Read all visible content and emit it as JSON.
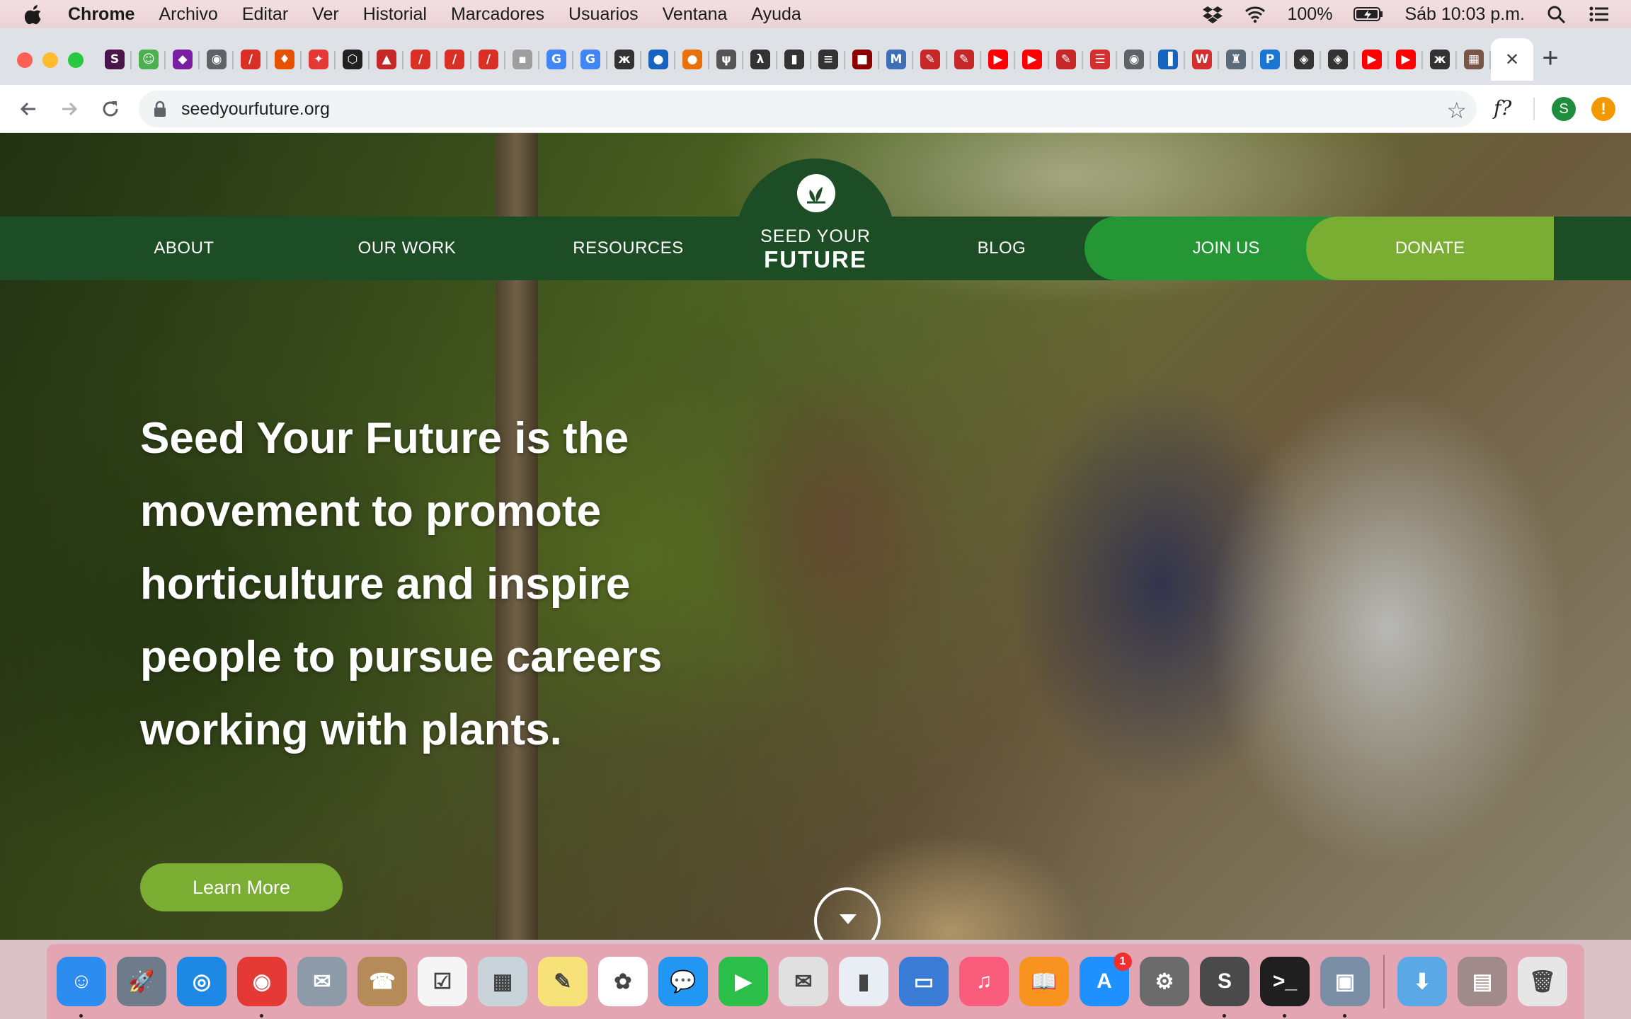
{
  "menubar": {
    "items": [
      "Chrome",
      "Archivo",
      "Editar",
      "Ver",
      "Historial",
      "Marcadores",
      "Usuarios",
      "Ventana",
      "Ayuda"
    ],
    "battery": "100%",
    "clock": "Sáb 10:03 p.m."
  },
  "browser": {
    "url": "seedyourfuture.org",
    "extension_label": "f?",
    "profile_initial": "S",
    "alert_symbol": "!",
    "tab_favicons": [
      {
        "glyph": "S",
        "color": "#4a154b"
      },
      {
        "glyph": "☺",
        "color": "#4caf50"
      },
      {
        "glyph": "◆",
        "color": "#7b1fa2"
      },
      {
        "glyph": "◉",
        "color": "#5f6368"
      },
      {
        "glyph": "/",
        "color": "#d93025"
      },
      {
        "glyph": "♦",
        "color": "#e65100"
      },
      {
        "glyph": "✦",
        "color": "#e53935"
      },
      {
        "glyph": "⬡",
        "color": "#212121"
      },
      {
        "glyph": "▲",
        "color": "#c62828"
      },
      {
        "glyph": "/",
        "color": "#d93025"
      },
      {
        "glyph": "/",
        "color": "#d93025"
      },
      {
        "glyph": "/",
        "color": "#d93025"
      },
      {
        "glyph": "▪",
        "color": "#9e9e9e"
      },
      {
        "glyph": "G",
        "color": "#4285f4"
      },
      {
        "glyph": "G",
        "color": "#4285f4"
      },
      {
        "glyph": "ж",
        "color": "#333333"
      },
      {
        "glyph": "●",
        "color": "#1565c0"
      },
      {
        "glyph": "●",
        "color": "#e8710a"
      },
      {
        "glyph": "ψ",
        "color": "#555555"
      },
      {
        "glyph": "λ",
        "color": "#333333"
      },
      {
        "glyph": "▮",
        "color": "#333333"
      },
      {
        "glyph": "≡",
        "color": "#333333"
      },
      {
        "glyph": "■",
        "color": "#8b0000"
      },
      {
        "glyph": "M",
        "color": "#3f6fb5"
      },
      {
        "glyph": "✎",
        "color": "#c62828"
      },
      {
        "glyph": "✎",
        "color": "#c62828"
      },
      {
        "glyph": "▶",
        "color": "#ff0000"
      },
      {
        "glyph": "▶",
        "color": "#ff0000"
      },
      {
        "glyph": "✎",
        "color": "#c62828"
      },
      {
        "glyph": "☰",
        "color": "#d32f2f"
      },
      {
        "glyph": "◉",
        "color": "#5f6368"
      },
      {
        "glyph": "▐",
        "color": "#1565c0"
      },
      {
        "glyph": "W",
        "color": "#d32f2f"
      },
      {
        "glyph": "♜",
        "color": "#5c6b7a"
      },
      {
        "glyph": "P",
        "color": "#1976d2"
      },
      {
        "glyph": "◈",
        "color": "#333333"
      },
      {
        "glyph": "◈",
        "color": "#333333"
      },
      {
        "glyph": "▶",
        "color": "#ff0000"
      },
      {
        "glyph": "▶",
        "color": "#ff0000"
      },
      {
        "glyph": "ж",
        "color": "#333333"
      },
      {
        "glyph": "▦",
        "color": "#795548"
      }
    ],
    "active_tab_close": "✕",
    "new_tab": "+"
  },
  "site": {
    "nav": {
      "about": "ABOUT",
      "our_work": "OUR WORK",
      "resources": "RESOURCES",
      "blog": "BLOG",
      "join": "JOIN US",
      "donate": "DONATE"
    },
    "logo": {
      "line1": "SEED YOUR",
      "line2": "FUTURE"
    },
    "hero_text": "Seed Your Future is the movement to promote horticulture and inspire people to pursue careers working with plants.",
    "cta_label": "Learn More",
    "colors": {
      "nav_green": "#1d4d24",
      "join_green": "#249633",
      "donate_green": "#7aae33"
    }
  },
  "dock": {
    "items": [
      {
        "glyph": "☺",
        "color": "#2d8cf0",
        "running": true
      },
      {
        "glyph": "🚀",
        "color": "#6e7b8b"
      },
      {
        "glyph": "◎",
        "color": "#1e88e5"
      },
      {
        "glyph": "◉",
        "color": "#e53935",
        "running": true
      },
      {
        "glyph": "✉",
        "color": "#8d9aa8"
      },
      {
        "glyph": "☎",
        "color": "#b58b5a"
      },
      {
        "glyph": "☑",
        "color": "#f5f5f5"
      },
      {
        "glyph": "▦",
        "color": "#c9d3da"
      },
      {
        "glyph": "✎",
        "color": "#f7e27a"
      },
      {
        "glyph": "✿",
        "color": "#ffffff"
      },
      {
        "glyph": "💬",
        "color": "#2196f3"
      },
      {
        "glyph": "▶",
        "color": "#2bbf4a"
      },
      {
        "glyph": "✉",
        "color": "#e0e0e0"
      },
      {
        "glyph": "▮",
        "color": "#e8eef3"
      },
      {
        "glyph": "▭",
        "color": "#3a7bd5"
      },
      {
        "glyph": "♫",
        "color": "#fa5c7c"
      },
      {
        "glyph": "📖",
        "color": "#f7931e"
      },
      {
        "glyph": "A",
        "color": "#1e90ff",
        "badge": "1"
      },
      {
        "glyph": "⚙",
        "color": "#6b6b6b"
      },
      {
        "glyph": "S",
        "color": "#4a4a4a",
        "running": true
      },
      {
        "glyph": ">_",
        "color": "#1f1f1f",
        "running": true
      },
      {
        "glyph": "▣",
        "color": "#7a8fa6",
        "running": true
      }
    ],
    "stack_items": [
      {
        "glyph": "⬇",
        "color": "#5aa9e6"
      },
      {
        "glyph": "▤",
        "color": "#a08a8a"
      },
      {
        "glyph": "🗑",
        "color": "#e6e6e6"
      }
    ]
  }
}
